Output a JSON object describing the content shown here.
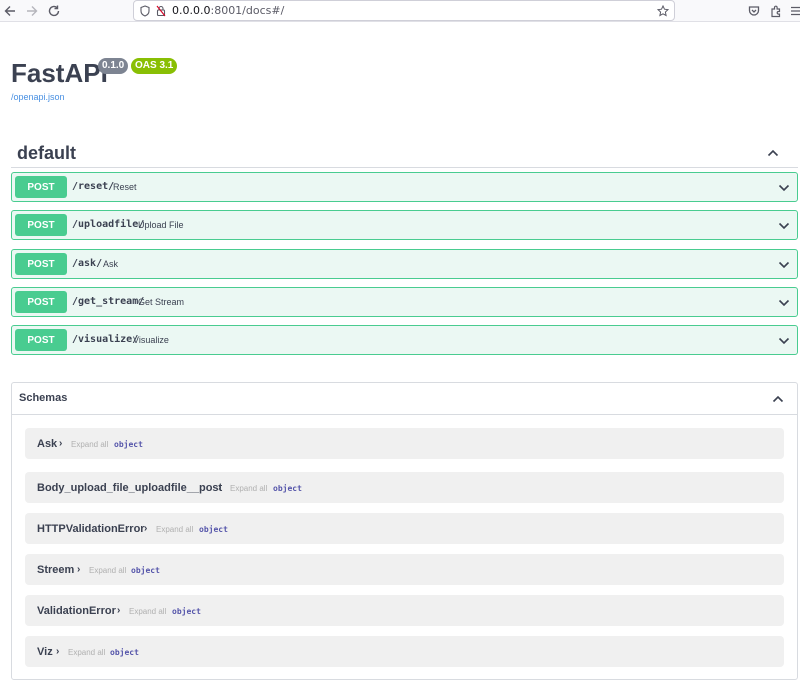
{
  "browser": {
    "url_host": "0.0.0.0",
    "url_rest": ":8001/docs#/"
  },
  "info": {
    "title": "FastAPI",
    "version": "0.1.0",
    "oas": "OAS 3.1",
    "spec_link": "/openapi.json"
  },
  "tag": {
    "name": "default"
  },
  "operations": [
    {
      "method": "POST",
      "path": "/reset/",
      "summary": "Reset"
    },
    {
      "method": "POST",
      "path": "/uploadfile/",
      "summary": "Upload File"
    },
    {
      "method": "POST",
      "path": "/ask/",
      "summary": "Ask"
    },
    {
      "method": "POST",
      "path": "/get_stream/",
      "summary": "Get Stream"
    },
    {
      "method": "POST",
      "path": "/visualize/",
      "summary": "Visualize"
    }
  ],
  "schemas": {
    "title": "Schemas",
    "expand_label": "Expand all",
    "type_label": "object",
    "toggle": "›",
    "models": [
      {
        "name": "Ask"
      },
      {
        "name": "Body_upload_file_uploadfile__post"
      },
      {
        "name": "HTTPValidationError"
      },
      {
        "name": "Streem"
      },
      {
        "name": "ValidationError"
      },
      {
        "name": "Viz"
      }
    ]
  },
  "colors": {
    "post": "#49cc90",
    "post_bg": "#ebf8f3",
    "version_badge": "#7d8492",
    "oas_badge": "#89bf04",
    "link": "#4990e2"
  }
}
